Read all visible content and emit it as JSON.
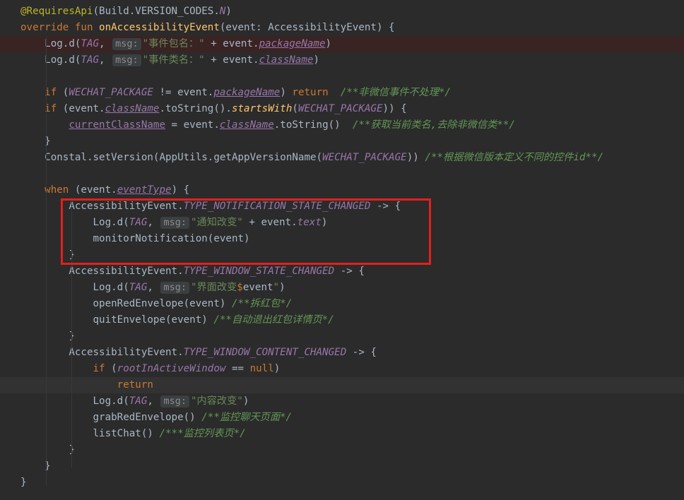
{
  "lines": [
    [
      [
        "ann",
        "@RequiresApi"
      ],
      [
        "t",
        "(Build.VERSION_CODES."
      ],
      [
        "const",
        "N"
      ],
      [
        "t",
        ")"
      ]
    ],
    [
      [
        "kw",
        "override fun "
      ],
      [
        "fn",
        "onAccessibilityEvent"
      ],
      [
        "t",
        "(event: AccessibilityEvent) {"
      ]
    ],
    [
      [
        "t",
        "    Log.d("
      ],
      [
        "const",
        "TAG"
      ],
      [
        "t",
        ", "
      ],
      [
        "hint",
        "msg:"
      ],
      [
        "str",
        "\"事件包名：\""
      ],
      [
        "t",
        " + event."
      ],
      [
        "prop",
        "packageName"
      ],
      [
        "t",
        ")"
      ]
    ],
    [
      [
        "t",
        "    Log.d("
      ],
      [
        "const",
        "TAG"
      ],
      [
        "t",
        ", "
      ],
      [
        "hint",
        "msg:"
      ],
      [
        "str",
        "\"事件类名：\""
      ],
      [
        "t",
        " + event."
      ],
      [
        "prop",
        "className"
      ],
      [
        "t",
        ")"
      ]
    ],
    [],
    [
      [
        "t",
        "    "
      ],
      [
        "kw",
        "if "
      ],
      [
        "t",
        "("
      ],
      [
        "const",
        "WECHAT_PACKAGE"
      ],
      [
        "t",
        " != event."
      ],
      [
        "prop",
        "packageName"
      ],
      [
        "t",
        ") "
      ],
      [
        "kw",
        "return  "
      ],
      [
        "cmt",
        "/**非微信事件不处理*/"
      ]
    ],
    [
      [
        "t",
        "    "
      ],
      [
        "kw",
        "if "
      ],
      [
        "t",
        "(event."
      ],
      [
        "prop",
        "className"
      ],
      [
        "t",
        ".toString()."
      ],
      [
        "ext",
        "startsWith"
      ],
      [
        "t",
        "("
      ],
      [
        "const",
        "WECHAT_PACKAGE"
      ],
      [
        "t",
        ")) {"
      ]
    ],
    [
      [
        "t",
        "        "
      ],
      [
        "var",
        "currentClassName"
      ],
      [
        "t",
        " = event."
      ],
      [
        "prop",
        "className"
      ],
      [
        "t",
        ".toString()  "
      ],
      [
        "cmt",
        "/**获取当前类名,去除非微信类**/"
      ]
    ],
    [
      [
        "t",
        "    }"
      ]
    ],
    [
      [
        "t",
        "    Constal.setVersion(AppUtils.getAppVersionName("
      ],
      [
        "const",
        "WECHAT_PACKAGE"
      ],
      [
        "t",
        ")) "
      ],
      [
        "cmt",
        "/**根据微信版本定义不同的控件id**/"
      ]
    ],
    [],
    [
      [
        "t",
        "    "
      ],
      [
        "kw",
        "when "
      ],
      [
        "t",
        "(event."
      ],
      [
        "prop",
        "eventType"
      ],
      [
        "t",
        ") {"
      ]
    ],
    [
      [
        "t",
        "        AccessibilityEvent."
      ],
      [
        "const",
        "TYPE_NOTIFICATION_STATE_CHANGED"
      ],
      [
        "t",
        " -> {"
      ]
    ],
    [
      [
        "t",
        "            Log.d("
      ],
      [
        "const",
        "TAG"
      ],
      [
        "t",
        ", "
      ],
      [
        "hint",
        "msg:"
      ],
      [
        "str",
        "\"通知改变\""
      ],
      [
        "t",
        " + event."
      ],
      [
        "propn",
        "text"
      ],
      [
        "t",
        ")"
      ]
    ],
    [
      [
        "t",
        "            monitorNotification(event)"
      ]
    ],
    [
      [
        "t",
        "        }"
      ]
    ],
    [
      [
        "t",
        "        AccessibilityEvent."
      ],
      [
        "const",
        "TYPE_WINDOW_STATE_CHANGED"
      ],
      [
        "t",
        " -> {"
      ]
    ],
    [
      [
        "t",
        "            Log.d("
      ],
      [
        "const",
        "TAG"
      ],
      [
        "t",
        ", "
      ],
      [
        "hint",
        "msg:"
      ],
      [
        "str",
        "\"界面改变"
      ],
      [
        "dollar",
        "$"
      ],
      [
        "t",
        "event"
      ],
      [
        "str",
        "\""
      ],
      [
        "t",
        ")"
      ]
    ],
    [
      [
        "t",
        "            openRedEnvelope(event) "
      ],
      [
        "cmt",
        "/**拆红包*/"
      ]
    ],
    [
      [
        "t",
        "            quitEnvelope(event) "
      ],
      [
        "cmt",
        "/**自动退出红包详情页*/"
      ]
    ],
    [
      [
        "t",
        "        }"
      ]
    ],
    [
      [
        "t",
        "        AccessibilityEvent."
      ],
      [
        "const",
        "TYPE_WINDOW_CONTENT_CHANGED"
      ],
      [
        "t",
        " -> {"
      ]
    ],
    [
      [
        "t",
        "            "
      ],
      [
        "kw",
        "if "
      ],
      [
        "t",
        "("
      ],
      [
        "propn",
        "rootInActiveWindow"
      ],
      [
        "t",
        " == "
      ],
      [
        "kw",
        "null"
      ],
      [
        "t",
        ")"
      ]
    ],
    [
      [
        "t",
        "                "
      ],
      [
        "kw",
        "return"
      ]
    ],
    [
      [
        "t",
        "            Log.d("
      ],
      [
        "const",
        "TAG"
      ],
      [
        "t",
        ", "
      ],
      [
        "hint",
        "msg:"
      ],
      [
        "str",
        "\"内容改变\""
      ],
      [
        "t",
        ")"
      ]
    ],
    [
      [
        "t",
        "            grabRedEnvelope() "
      ],
      [
        "cmt",
        "/**监控聊天页面*/"
      ]
    ],
    [
      [
        "t",
        "            listChat() "
      ],
      [
        "cmt",
        "/***监控列表页*/"
      ]
    ],
    [
      [
        "t",
        "        }"
      ]
    ],
    [
      [
        "t",
        "    }"
      ]
    ],
    [
      [
        "t",
        "}"
      ]
    ]
  ],
  "highlighted_lines": {
    "error": 2,
    "caret": 23
  },
  "colors": {
    "background": "#2b2b2b",
    "keyword": "#cc7832",
    "annotation": "#bbb529",
    "function": "#ffc66d",
    "string": "#6a8759",
    "constant": "#9876aa",
    "comment": "#629755",
    "highlight_box": "#e4201c"
  }
}
